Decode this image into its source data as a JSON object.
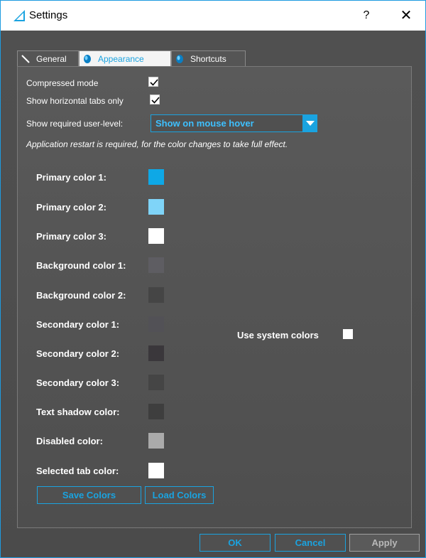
{
  "window": {
    "title": "Settings",
    "help_label": "?",
    "close_label": "✕"
  },
  "tabs": [
    {
      "label": "General",
      "icon": "wrench-icon"
    },
    {
      "label": "Appearance",
      "icon": "drop-icon"
    },
    {
      "label": "Shortcuts",
      "icon": "drop-icon"
    }
  ],
  "options": {
    "compressed_mode": {
      "label": "Compressed mode",
      "checked": true
    },
    "horizontal_tabs": {
      "label": "Show horizontal tabs only",
      "checked": true
    },
    "user_level": {
      "label": "Show required user-level:",
      "value": "Show on mouse hover"
    }
  },
  "note": "Application restart is required, for the color changes to take full effect.",
  "colors": [
    {
      "label": "Primary color 1:",
      "value": "#0ea8e6"
    },
    {
      "label": "Primary color 2:",
      "value": "#7fd4f8"
    },
    {
      "label": "Primary color 3:",
      "value": "#ffffff"
    },
    {
      "label": "Background color 1:",
      "value": "#5e5d62"
    },
    {
      "label": "Background color 2:",
      "value": "#454545"
    },
    {
      "label": "Secondary color 1:",
      "value": "#525156"
    },
    {
      "label": "Secondary color 2:",
      "value": "#3a373b"
    },
    {
      "label": "Secondary color 3:",
      "value": "#454545"
    },
    {
      "label": "Text shadow color:",
      "value": "#3e3e3e"
    },
    {
      "label": "Disabled color:",
      "value": "#aaaaaa"
    },
    {
      "label": "Selected tab color:",
      "value": "#ffffff"
    }
  ],
  "use_system_colors": {
    "label": "Use system colors",
    "checked": false
  },
  "buttons": {
    "save_colors": "Save Colors",
    "load_colors": "Load Colors",
    "ok": "OK",
    "cancel": "Cancel",
    "apply": "Apply"
  },
  "accent_color": "#1aa3e0"
}
